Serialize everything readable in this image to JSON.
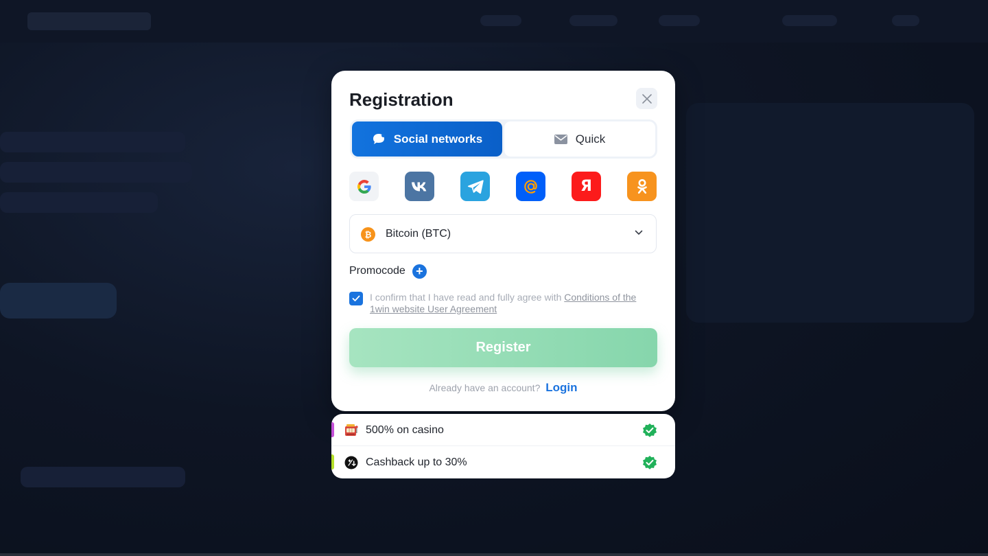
{
  "modal": {
    "title": "Registration",
    "tabs": [
      {
        "label": "Social networks",
        "icon": "chat-bubble-icon",
        "active": true
      },
      {
        "label": "Quick",
        "icon": "envelope-icon",
        "active": false
      }
    ],
    "social_providers": [
      {
        "name": "google",
        "glyph": "G",
        "bg": "#f1f3f6",
        "color": "#4285f4"
      },
      {
        "name": "vk",
        "glyph": "VK",
        "bg": "#4c75a3",
        "color": "#ffffff"
      },
      {
        "name": "telegram",
        "glyph": "",
        "bg": "#2aa3df",
        "color": "#ffffff"
      },
      {
        "name": "mail-ru",
        "glyph": "@",
        "bg": "#005ff9",
        "color": "#ff9e00"
      },
      {
        "name": "yandex",
        "glyph": "Я",
        "bg": "#fc1b1b",
        "color": "#ffffff"
      },
      {
        "name": "odnoklassniki",
        "glyph": "",
        "bg": "#f7931e",
        "color": "#ffffff"
      }
    ],
    "currency": {
      "label": "Bitcoin (BTC)",
      "icon_glyph": "₿"
    },
    "promocode_label": "Promocode",
    "agreement": {
      "checked": true,
      "text": "I confirm that I have read and fully agree with ",
      "link_text": "Conditions of the 1win website User Agreement"
    },
    "register_label": "Register",
    "login_prompt": "Already have an account?",
    "login_link": "Login"
  },
  "bonuses": [
    {
      "label": "500% on casino",
      "icon": "slot-machine-icon",
      "accent": "#c44fd8"
    },
    {
      "label": "Cashback up to 30%",
      "icon": "cashback-coin-icon",
      "accent": "#b5e02a"
    }
  ],
  "colors": {
    "primary": "#1273de",
    "register_green": "#86d6ac",
    "check_green": "#21b15a"
  }
}
